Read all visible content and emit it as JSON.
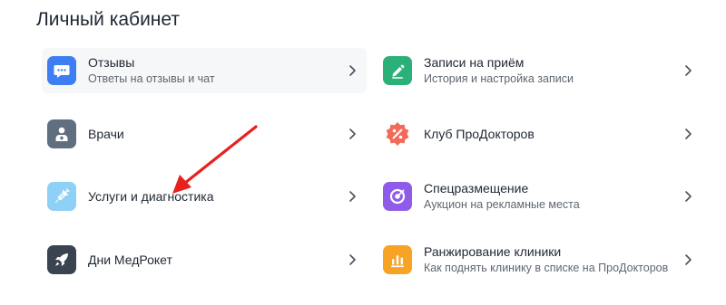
{
  "page": {
    "title": "Личный кабинет"
  },
  "menu": {
    "reviews": {
      "title": "Отзывы",
      "subtitle": "Ответы на отзывы и чат",
      "icon": "chat-bubble-icon",
      "color": "#3d7ff2"
    },
    "appointments": {
      "title": "Записи на приём",
      "subtitle": "История и настройка записи",
      "icon": "pencil-icon",
      "color": "#2cb079"
    },
    "doctors": {
      "title": "Врачи",
      "icon": "doctor-icon",
      "color": "#5f6f80"
    },
    "club": {
      "title": "Клуб ПроДокторов",
      "icon": "percent-badge-icon",
      "color": "#f26a5a"
    },
    "services": {
      "title": "Услуги и диагностика",
      "icon": "syringe-icon",
      "color": "#8fd0f7"
    },
    "placement": {
      "title": "Спецразмещение",
      "subtitle": "Аукцион на рекламные места",
      "icon": "target-icon",
      "color": "#8f5be8"
    },
    "medrocket": {
      "title": "Дни МедРокет",
      "icon": "rocket-icon",
      "color": "#3a4350"
    },
    "ranking": {
      "title": "Ранжирование клиники",
      "subtitle": "Как поднять клинику в списке на ПроДокторов",
      "icon": "bar-chart-icon",
      "color": "#f7a324"
    }
  },
  "annotation": {
    "color": "#e8201e"
  }
}
